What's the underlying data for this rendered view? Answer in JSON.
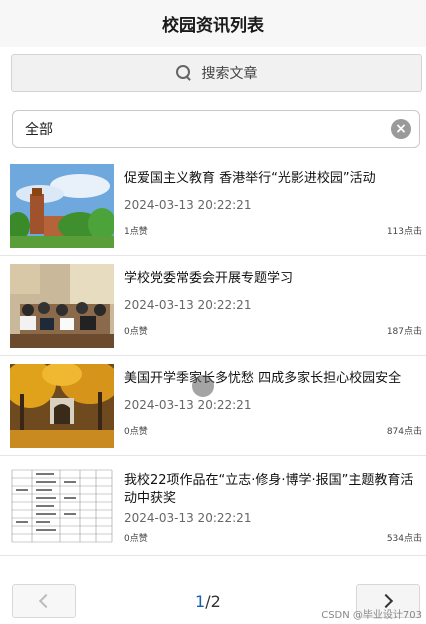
{
  "header": {
    "title": "校园资讯列表"
  },
  "search": {
    "label": "搜索文章"
  },
  "filter": {
    "value": "全部"
  },
  "articles": [
    {
      "title": "促爱国主义教育 香港举行“光影进校园”活动",
      "date": "2024-03-13 20:22:21",
      "likes": "1点赞",
      "clicks": "113点击"
    },
    {
      "title": "学校党委常委会开展专题学习",
      "date": "2024-03-13 20:22:21",
      "likes": "0点赞",
      "clicks": "187点击"
    },
    {
      "title": "美国开学季家长多忧愁 四成多家长担心校园安全",
      "date": "2024-03-13 20:22:21",
      "likes": "0点赞",
      "clicks": "874点击"
    },
    {
      "title": "我校22项作品在“立志·修身·博学·报国”主题教育活动中获奖",
      "date": "2024-03-13 20:22:21",
      "likes": "0点赞",
      "clicks": "534点击"
    }
  ],
  "pager": {
    "current": "1",
    "total": "/2"
  },
  "watermark": "CSDN @毕业设计703",
  "colors": {
    "accent": "#1a5fb4",
    "header_bg": "#f7f7f7"
  },
  "icons": {
    "search": "search-icon",
    "clear": "clear-icon",
    "prev": "chevron-left-icon",
    "next": "chevron-right-icon"
  }
}
